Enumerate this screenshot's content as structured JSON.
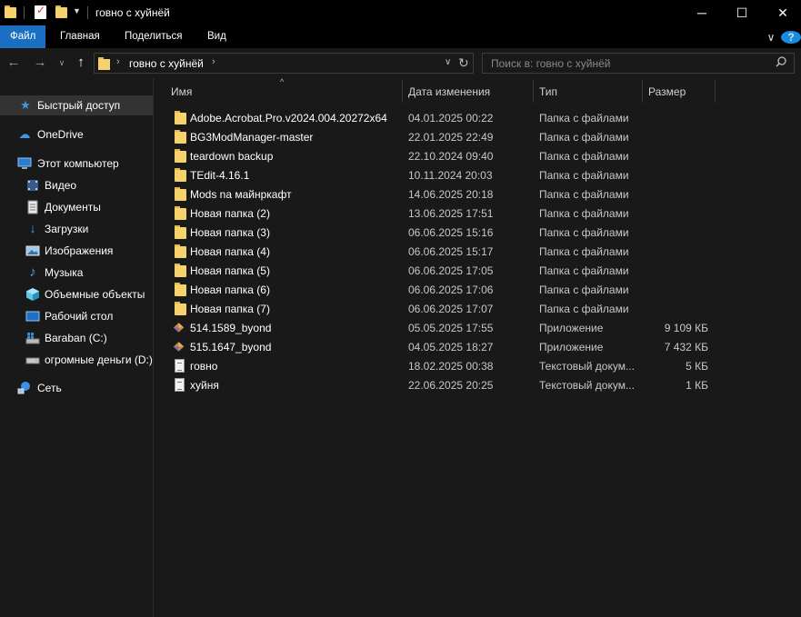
{
  "window": {
    "title": "говно с хуйнёй",
    "controls": {
      "minimize": "─",
      "maximize": "☐",
      "close": "✕"
    }
  },
  "ribbon": {
    "tabs": [
      {
        "label": "Файл",
        "active": true
      },
      {
        "label": "Главная",
        "active": false
      },
      {
        "label": "Поделиться",
        "active": false
      },
      {
        "label": "Вид",
        "active": false
      }
    ]
  },
  "address": {
    "path": "говно с хуйнёй",
    "search_placeholder": "Поиск в: говно с хуйнёй"
  },
  "sidebar": {
    "items": [
      {
        "label": "Быстрый доступ",
        "icon": "star-icon",
        "selected": true
      },
      {
        "label": "OneDrive",
        "icon": "cloud-icon",
        "selected": false
      },
      {
        "label": "Этот компьютер",
        "icon": "computer-icon",
        "selected": false
      },
      {
        "label": "Видео",
        "icon": "video-icon",
        "selected": false
      },
      {
        "label": "Документы",
        "icon": "documents-icon",
        "selected": false
      },
      {
        "label": "Загрузки",
        "icon": "downloads-icon",
        "selected": false
      },
      {
        "label": "Изображения",
        "icon": "pictures-icon",
        "selected": false
      },
      {
        "label": "Музыка",
        "icon": "music-icon",
        "selected": false
      },
      {
        "label": "Объемные объекты",
        "icon": "3d-objects-icon",
        "selected": false
      },
      {
        "label": "Рабочий стол",
        "icon": "desktop-icon",
        "selected": false
      },
      {
        "label": "Baraban (C:)",
        "icon": "windows-drive-icon",
        "selected": false
      },
      {
        "label": "огромные деньги (D:)",
        "icon": "drive-icon",
        "selected": false
      },
      {
        "label": "Сеть",
        "icon": "network-icon",
        "selected": false
      }
    ]
  },
  "columns": {
    "name": "Имя",
    "date": "Дата изменения",
    "type": "Тип",
    "size": "Размер"
  },
  "files": [
    {
      "name": "Adobe.Acrobat.Pro.v2024.004.20272x64",
      "date": "04.01.2025 00:22",
      "type": "Папка с файлами",
      "size": "",
      "icon": "folder-icon"
    },
    {
      "name": "BG3ModManager-master",
      "date": "22.01.2025 22:49",
      "type": "Папка с файлами",
      "size": "",
      "icon": "folder-icon"
    },
    {
      "name": "teardown backup",
      "date": "22.10.2024 09:40",
      "type": "Папка с файлами",
      "size": "",
      "icon": "folder-icon"
    },
    {
      "name": "TEdit-4.16.1",
      "date": "10.11.2024 20:03",
      "type": "Папка с файлами",
      "size": "",
      "icon": "folder-icon"
    },
    {
      "name": "Mods na майнркафт",
      "date": "14.06.2025 20:18",
      "type": "Папка с файлами",
      "size": "",
      "icon": "folder-icon"
    },
    {
      "name": "Новая папка (2)",
      "date": "13.06.2025 17:51",
      "type": "Папка с файлами",
      "size": "",
      "icon": "folder-icon"
    },
    {
      "name": "Новая папка (3)",
      "date": "06.06.2025 15:16",
      "type": "Папка с файлами",
      "size": "",
      "icon": "folder-icon"
    },
    {
      "name": "Новая папка (4)",
      "date": "06.06.2025 15:17",
      "type": "Папка с файлами",
      "size": "",
      "icon": "folder-icon"
    },
    {
      "name": "Новая папка (5)",
      "date": "06.06.2025 17:05",
      "type": "Папка с файлами",
      "size": "",
      "icon": "folder-icon"
    },
    {
      "name": "Новая папка (6)",
      "date": "06.06.2025 17:06",
      "type": "Папка с файлами",
      "size": "",
      "icon": "folder-icon"
    },
    {
      "name": "Новая папка (7)",
      "date": "06.06.2025 17:07",
      "type": "Папка с файлами",
      "size": "",
      "icon": "folder-icon"
    },
    {
      "name": "514.1589_byond",
      "date": "05.05.2025 17:55",
      "type": "Приложение",
      "size": "9 109 КБ",
      "icon": "app-icon"
    },
    {
      "name": "515.1647_byond",
      "date": "04.05.2025 18:27",
      "type": "Приложение",
      "size": "7 432 КБ",
      "icon": "app-icon"
    },
    {
      "name": "говно",
      "date": "18.02.2025 00:38",
      "type": "Текстовый докум...",
      "size": "5 КБ",
      "icon": "text-file-icon"
    },
    {
      "name": "хуйня",
      "date": "22.06.2025 20:25",
      "type": "Текстовый докум...",
      "size": "1 КБ",
      "icon": "text-file-icon"
    }
  ],
  "colors": {
    "background": "#191919",
    "titlebar": "#000000",
    "accent": "#1a6fc2",
    "selection": "#333333",
    "folder": "#f5d26b"
  }
}
